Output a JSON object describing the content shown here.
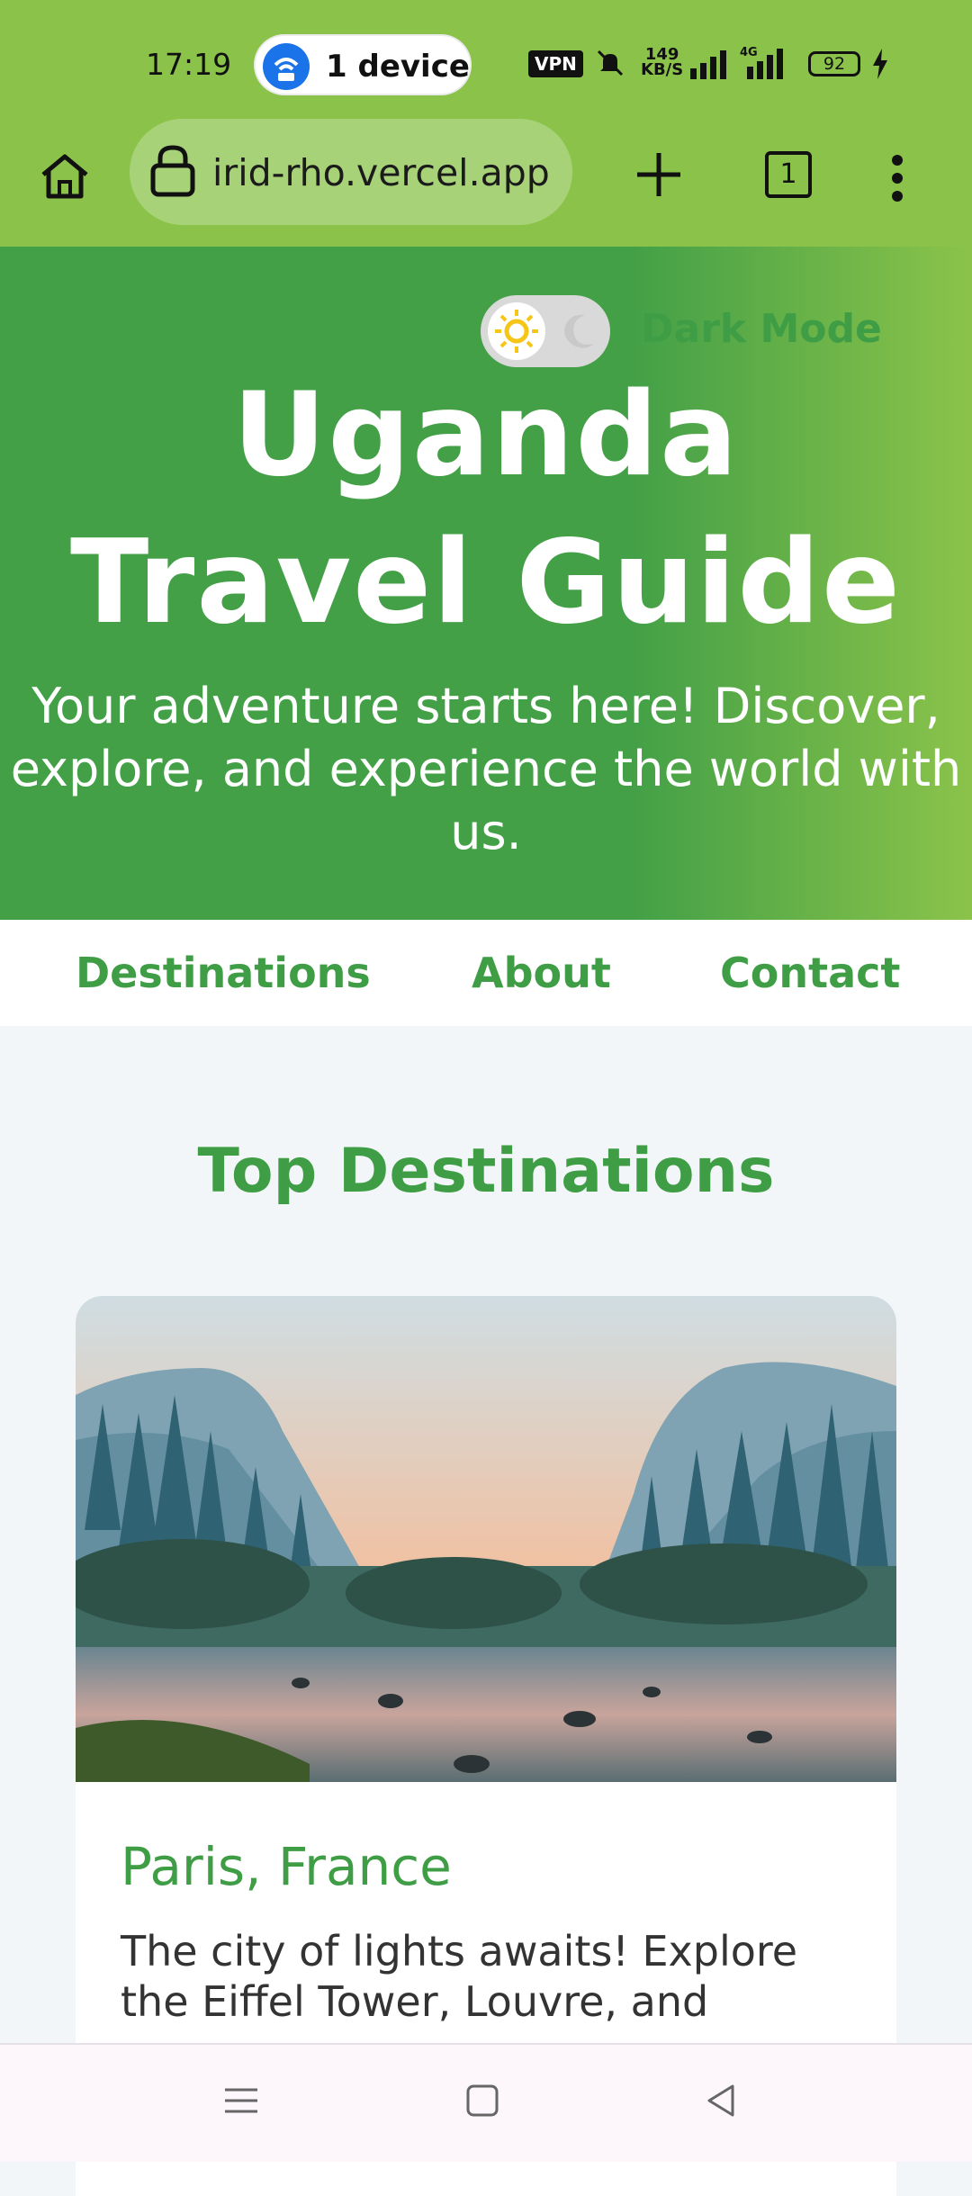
{
  "status_bar": {
    "time": "17:19",
    "hotspot_label": "1 device",
    "vpn_label": "VPN",
    "speed_value": "149",
    "speed_unit": "KB/S",
    "network_type": "4G",
    "battery_level": "92",
    "icons": [
      "hotspot-icon",
      "vpn-icon",
      "mute-icon",
      "signal-icon",
      "signal-4g-icon",
      "battery-icon",
      "charging-icon"
    ]
  },
  "browser": {
    "url": "irid-rho.vercel.app",
    "tab_count": "1",
    "icons": [
      "home-icon",
      "lock-icon",
      "plus-icon",
      "tabs-icon",
      "more-vert-icon"
    ]
  },
  "hero": {
    "toggle_label": "Dark Mode",
    "title_line1": "Uganda",
    "title_line2": "Travel Guide",
    "subtitle": "Your adventure starts here! Discover, explore, and experience the world with us.",
    "colors": {
      "gradient_start": "#43a047",
      "gradient_end": "#8bc34a"
    }
  },
  "nav": {
    "items": [
      {
        "label": "Destinations"
      },
      {
        "label": "About"
      },
      {
        "label": "Contact"
      }
    ]
  },
  "main": {
    "section_title": "Top Destinations",
    "cards": [
      {
        "title": "Paris, France",
        "description": "The city of lights awaits! Explore the Eiffel Tower, Louvre, and",
        "image": "valley-landscape"
      }
    ]
  },
  "theme": {
    "accent": "#3f9e45",
    "browser_bar": "#8bc34a",
    "page_bg": "#f2f6f8"
  },
  "system_nav": {
    "icons": [
      "menu-icon",
      "home-square-icon",
      "back-icon"
    ]
  }
}
